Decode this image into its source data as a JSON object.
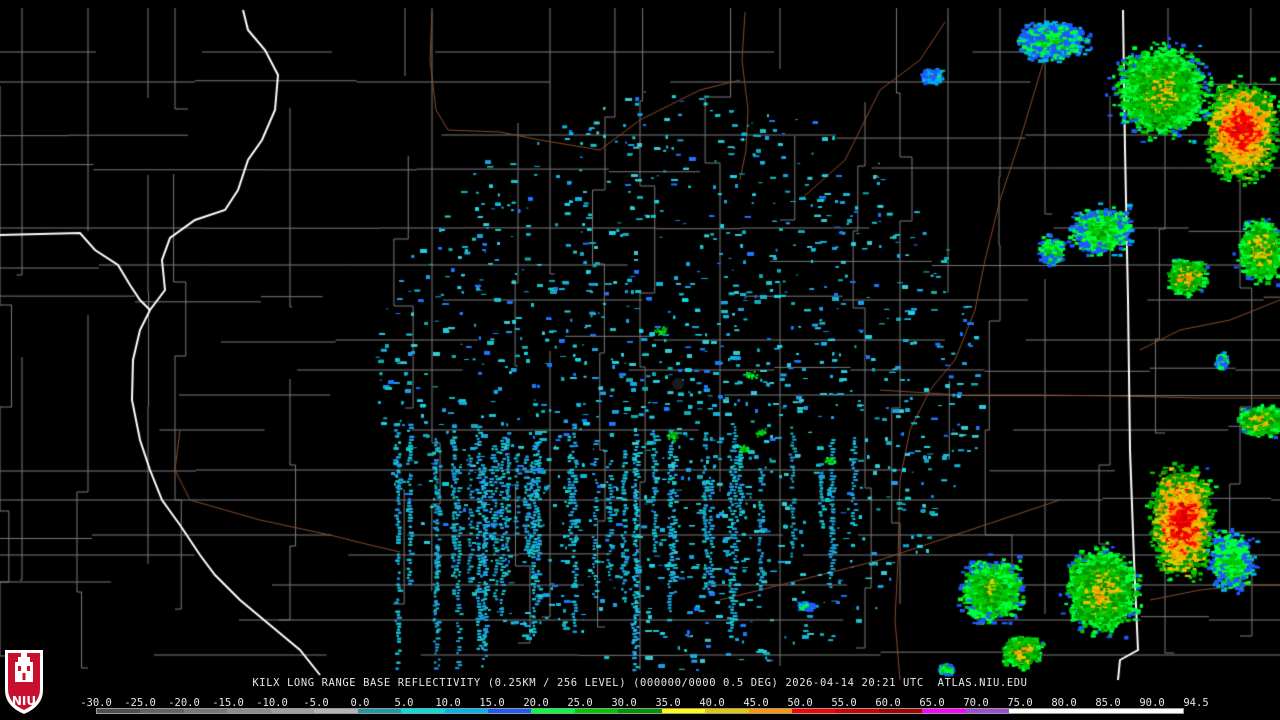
{
  "caption": "KILX LONG RANGE BASE REFLECTIVITY (0.25KM / 256 LEVEL) (000000/0000 0.5 DEG) 2026-04-14 20:21 UTC  ATLAS.NIU.EDU",
  "logo": {
    "icon": "niu-logo",
    "text": "NIU"
  },
  "scale": {
    "labels": [
      "-30.0",
      "-25.0",
      "-20.0",
      "-15.0",
      "-10.0",
      "-5.0",
      "0.0",
      "5.0",
      "10.0",
      "15.0",
      "20.0",
      "25.0",
      "30.0",
      "35.0",
      "40.0",
      "45.0",
      "50.0",
      "55.0",
      "60.0",
      "65.0",
      "70.0",
      "75.0",
      "80.0",
      "85.0",
      "90.0",
      "94.5"
    ],
    "colors": [
      "#505050",
      "#646464",
      "#787878",
      "#8c8c8c",
      "#a0a0a0",
      "#b4b4b4",
      "#1e9aa0",
      "#00e0e0",
      "#00b4f0",
      "#1e5aff",
      "#00ff3c",
      "#00c800",
      "#009600",
      "#ffff00",
      "#e6c800",
      "#ff9600",
      "#ff0000",
      "#d20000",
      "#aa0000",
      "#ff00ff",
      "#9a50d0",
      "#ffffff",
      "#ffffff",
      "#ffffff",
      "#ffffff"
    ]
  },
  "colors": {
    "background": "#000000",
    "county_lines": "#7a7a7a",
    "state_lines": "#ffffff",
    "rivers": "#8a4a2a",
    "radar_site": "#1a1a1a"
  }
}
